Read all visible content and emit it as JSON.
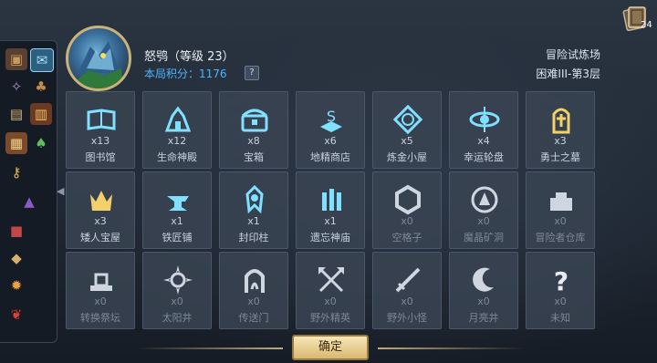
{
  "player": {
    "name_level": "怒鸮（等级 23）",
    "score_label": "本局积分：1176",
    "help": "?"
  },
  "mode": {
    "title": "冒险试炼场",
    "floor": "困难III-第3层"
  },
  "deck_count": "24",
  "confirm_label": "确定",
  "sidebar_items": [
    "chest-icon",
    "speech-bubble-icon",
    "purple-gem-icon",
    "pouch-icon",
    "scroll-icon",
    "red-book-icon",
    "brown-book-icon",
    "leaf-icon",
    "key-icon",
    "wizard-hat-icon",
    "top-hat-icon",
    "paper-icon",
    "lantern-icon",
    "pepper-icon"
  ],
  "locations": [
    {
      "count": "x13",
      "name": "图书馆",
      "icon": "book-icon",
      "active": true
    },
    {
      "count": "x12",
      "name": "生命神殿",
      "icon": "temple-icon",
      "active": true
    },
    {
      "count": "x8",
      "name": "宝箱",
      "icon": "treasure-chest-icon",
      "active": true
    },
    {
      "count": "x6",
      "name": "地精商店",
      "icon": "shop-icon",
      "active": true
    },
    {
      "count": "x5",
      "name": "炼金小屋",
      "icon": "alchemy-icon",
      "active": true
    },
    {
      "count": "x4",
      "name": "幸运轮盘",
      "icon": "wheel-icon",
      "active": true
    },
    {
      "count": "x3",
      "name": "勇士之墓",
      "icon": "tomb-icon",
      "active": true
    },
    {
      "count": "x3",
      "name": "矮人宝屋",
      "icon": "helmet-icon",
      "active": true
    },
    {
      "count": "x1",
      "name": "铁匠铺",
      "icon": "anvil-icon",
      "active": true
    },
    {
      "count": "x1",
      "name": "封印柱",
      "icon": "seal-icon",
      "active": true
    },
    {
      "count": "x1",
      "name": "遗忘神庙",
      "icon": "shrine-icon",
      "active": true
    },
    {
      "count": "x0",
      "name": "空格子",
      "icon": "hexagon-icon",
      "active": false
    },
    {
      "count": "x0",
      "name": "魔晶矿洞",
      "icon": "crystal-mine-icon",
      "active": false
    },
    {
      "count": "x0",
      "name": "冒险者仓库",
      "icon": "warehouse-icon",
      "active": false
    },
    {
      "count": "x0",
      "name": "转换祭坛",
      "icon": "altar-icon",
      "active": false
    },
    {
      "count": "x0",
      "name": "太阳井",
      "icon": "sun-icon",
      "active": false
    },
    {
      "count": "x0",
      "name": "传送门",
      "icon": "portal-icon",
      "active": false
    },
    {
      "count": "x0",
      "name": "野外精英",
      "icon": "crossed-axes-icon",
      "active": false
    },
    {
      "count": "x0",
      "name": "野外小怪",
      "icon": "crossed-swords-icon",
      "active": false
    },
    {
      "count": "x0",
      "name": "月亮井",
      "icon": "moon-icon",
      "active": false
    },
    {
      "count": "x0",
      "name": "未知",
      "icon": "question-icon",
      "active": false
    }
  ]
}
